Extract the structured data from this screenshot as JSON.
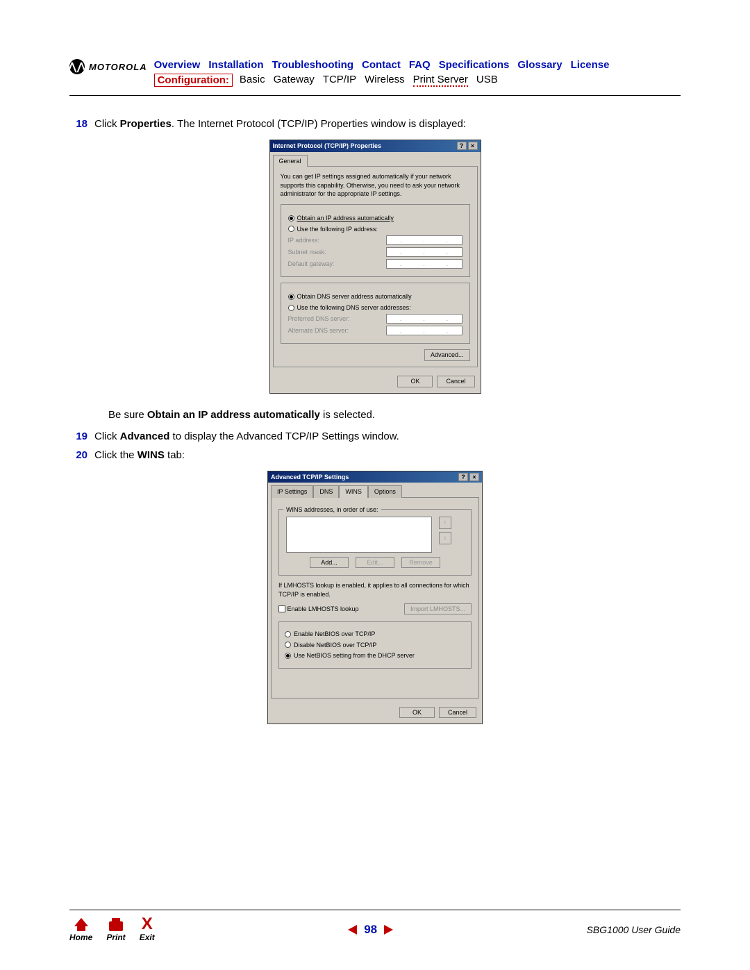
{
  "brand": "MOTOROLA",
  "top_nav": [
    "Overview",
    "Installation",
    "Troubleshooting",
    "Contact",
    "FAQ",
    "Specifications",
    "Glossary",
    "License"
  ],
  "sub_nav": {
    "label": "Configuration:",
    "items": [
      "Basic",
      "Gateway",
      "TCP/IP",
      "Wireless",
      "Print Server",
      "USB"
    ],
    "dotted_index": 4
  },
  "steps": {
    "s18": {
      "num": "18",
      "pre": "Click ",
      "bold": "Properties",
      "post": ". The Internet Protocol (TCP/IP) Properties window is displayed:"
    },
    "note": {
      "pre": "Be sure ",
      "bold": "Obtain an IP address automatically",
      "post": " is selected."
    },
    "s19": {
      "num": "19",
      "pre": "Click ",
      "bold": "Advanced",
      "post": " to display the Advanced TCP/IP Settings window."
    },
    "s20": {
      "num": "20",
      "pre": "Click the ",
      "bold": "WINS",
      "post": " tab:"
    }
  },
  "win1": {
    "title": "Internet Protocol (TCP/IP) Properties",
    "tab": "General",
    "desc": "You can get IP settings assigned automatically if your network supports this capability. Otherwise, you need to ask your network administrator for the appropriate IP settings.",
    "r1": "Obtain an IP address automatically",
    "r2": "Use the following IP address:",
    "ip": "IP address:",
    "mask": "Subnet mask:",
    "gw": "Default gateway:",
    "r3": "Obtain DNS server address automatically",
    "r4": "Use the following DNS server addresses:",
    "dns1": "Preferred DNS server:",
    "dns2": "Alternate DNS server:",
    "adv": "Advanced...",
    "ok": "OK",
    "cancel": "Cancel"
  },
  "win2": {
    "title": "Advanced TCP/IP Settings",
    "tabs": [
      "IP Settings",
      "DNS",
      "WINS",
      "Options"
    ],
    "active_tab": 2,
    "group1": "WINS addresses, in order of use:",
    "add": "Add...",
    "edit": "Edit...",
    "remove": "Remove",
    "lmhosts_text": "If LMHOSTS lookup is enabled, it applies to all connections for which TCP/IP is enabled.",
    "enable_lmhosts": "Enable LMHOSTS lookup",
    "import": "Import LMHOSTS...",
    "rb1": "Enable NetBIOS over TCP/IP",
    "rb2": "Disable NetBIOS over TCP/IP",
    "rb3": "Use NetBIOS setting from the DHCP server",
    "ok": "OK",
    "cancel": "Cancel"
  },
  "footer": {
    "home": "Home",
    "print": "Print",
    "exit": "Exit",
    "page": "98",
    "guide": "SBG1000 User Guide"
  }
}
